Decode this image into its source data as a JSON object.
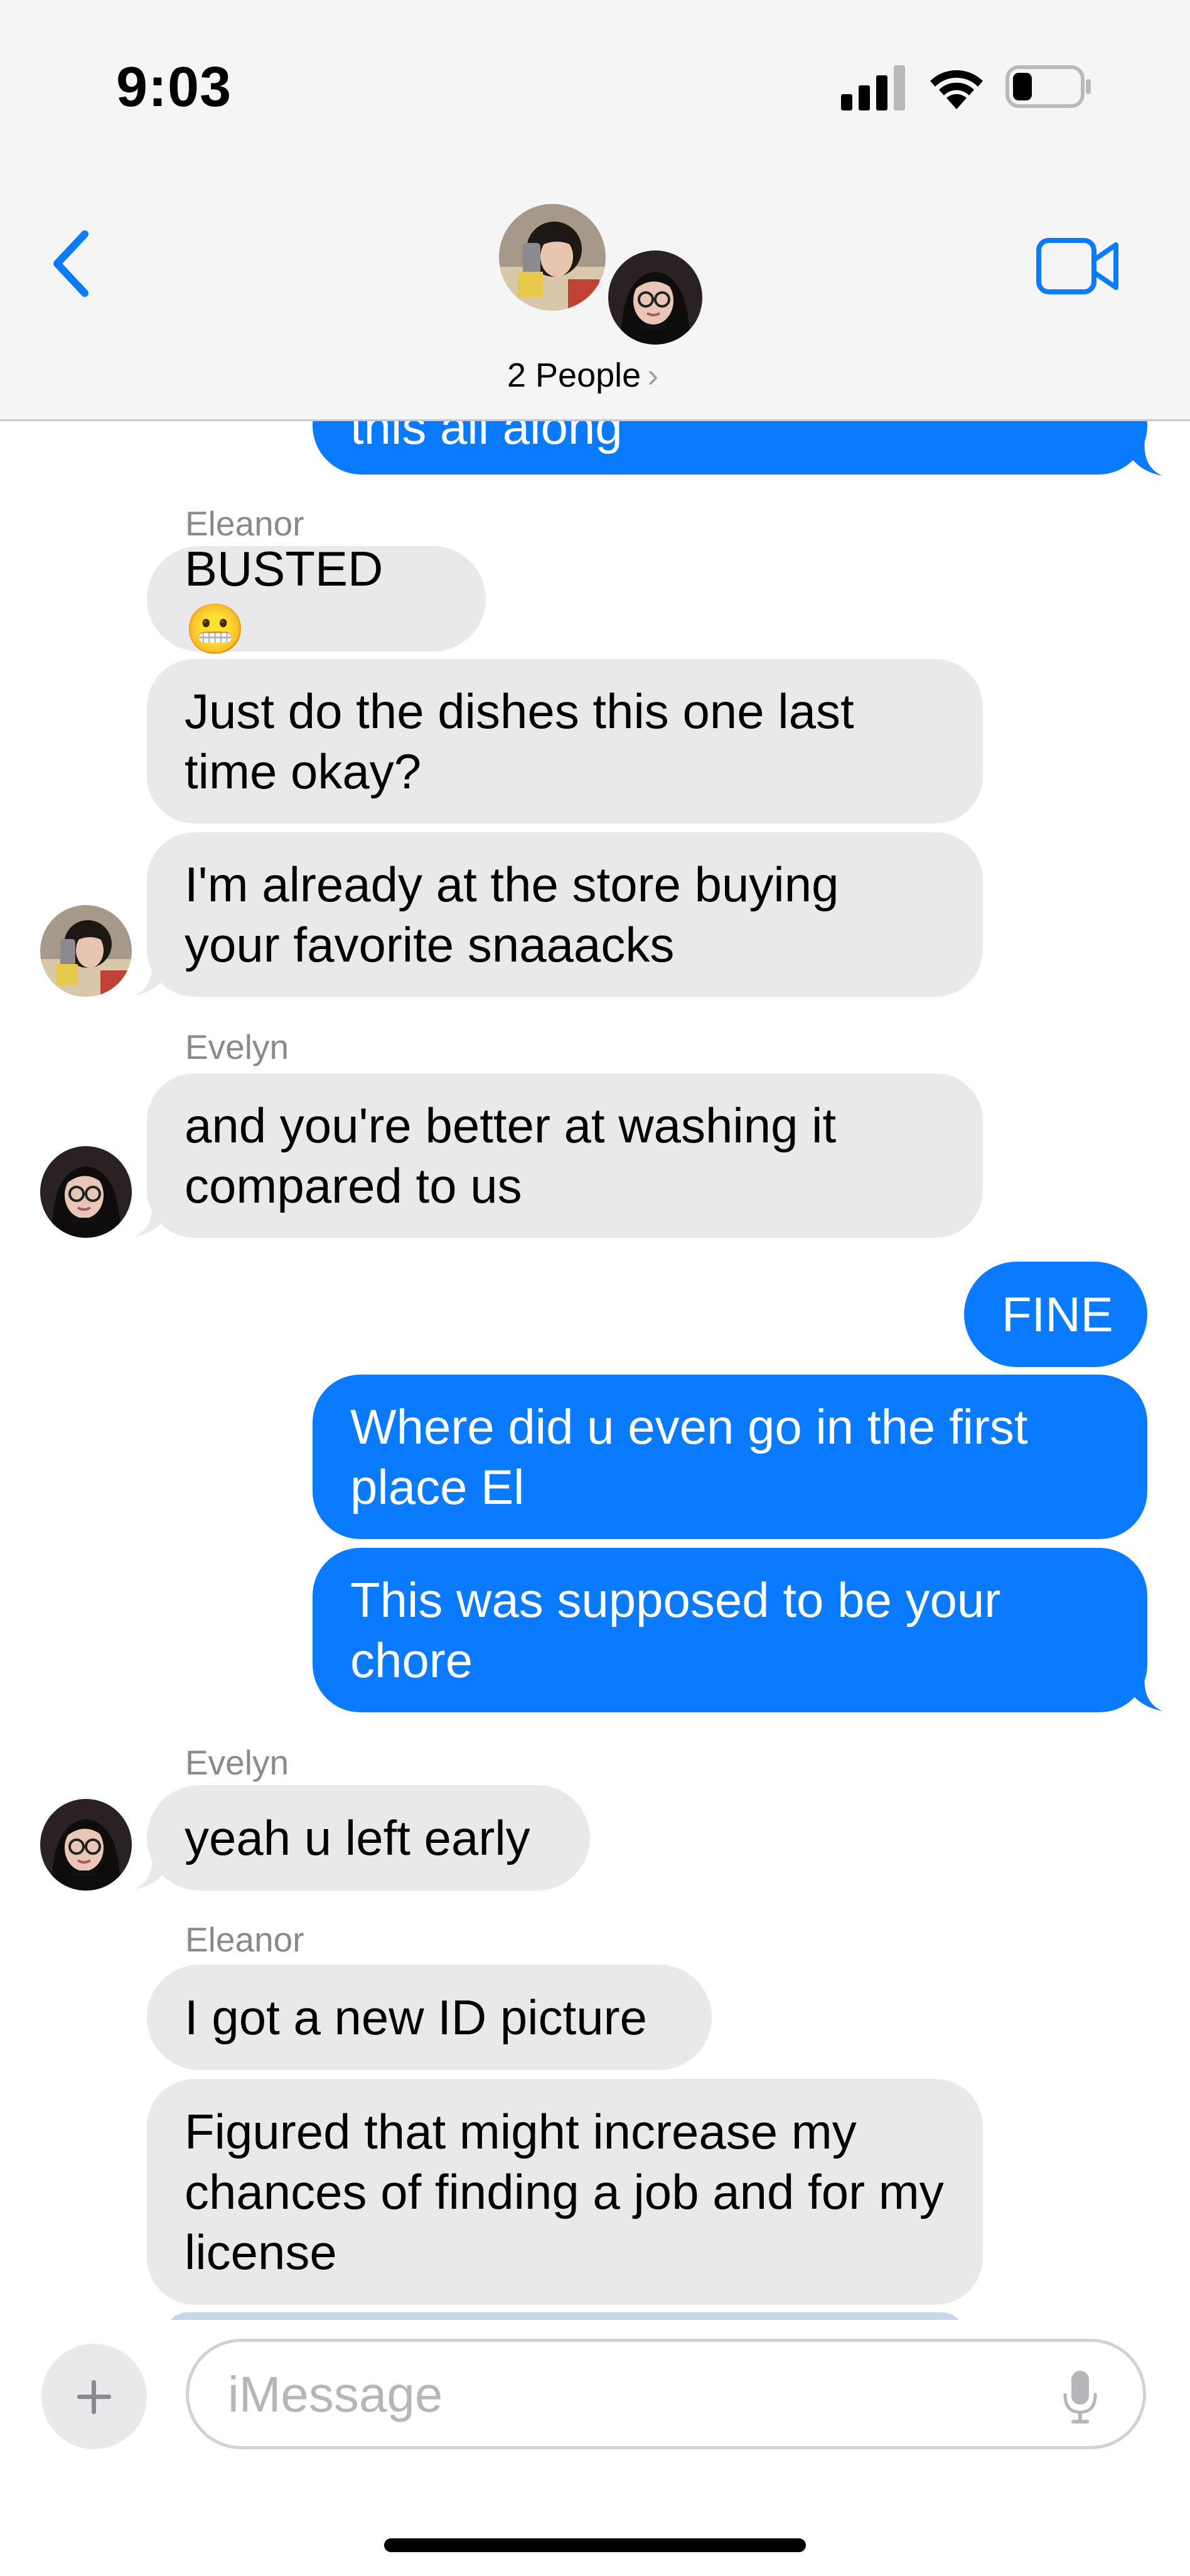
{
  "status": {
    "time": "9:03"
  },
  "header": {
    "people_label": "2 People",
    "chevron": "›"
  },
  "composer": {
    "placeholder": "iMessage",
    "plus": "+"
  },
  "participants": [
    "Eleanor",
    "Evelyn"
  ],
  "messages": {
    "m0": "this all along",
    "name1": "Eleanor",
    "m1": "BUSTED 😬",
    "m2": "Just do the dishes this one last time okay?",
    "m3": "I'm already at the store buying your favorite snaaacks",
    "name2": "Evelyn",
    "m4": "and you're better at washing it compared to us",
    "m5": "FINE",
    "m6": "Where did u even go in the first place El",
    "m7": "This was supposed to be your chore",
    "name3": "Evelyn",
    "m8": "yeah u left early",
    "name4": "Eleanor",
    "m9": "I got a new ID picture",
    "m10": "Figured that might increase my chances of finding a job and for my license"
  },
  "colors": {
    "outgoing": "#0a7aff",
    "incoming": "#e9e9eb",
    "accent": "#0a7aff"
  }
}
